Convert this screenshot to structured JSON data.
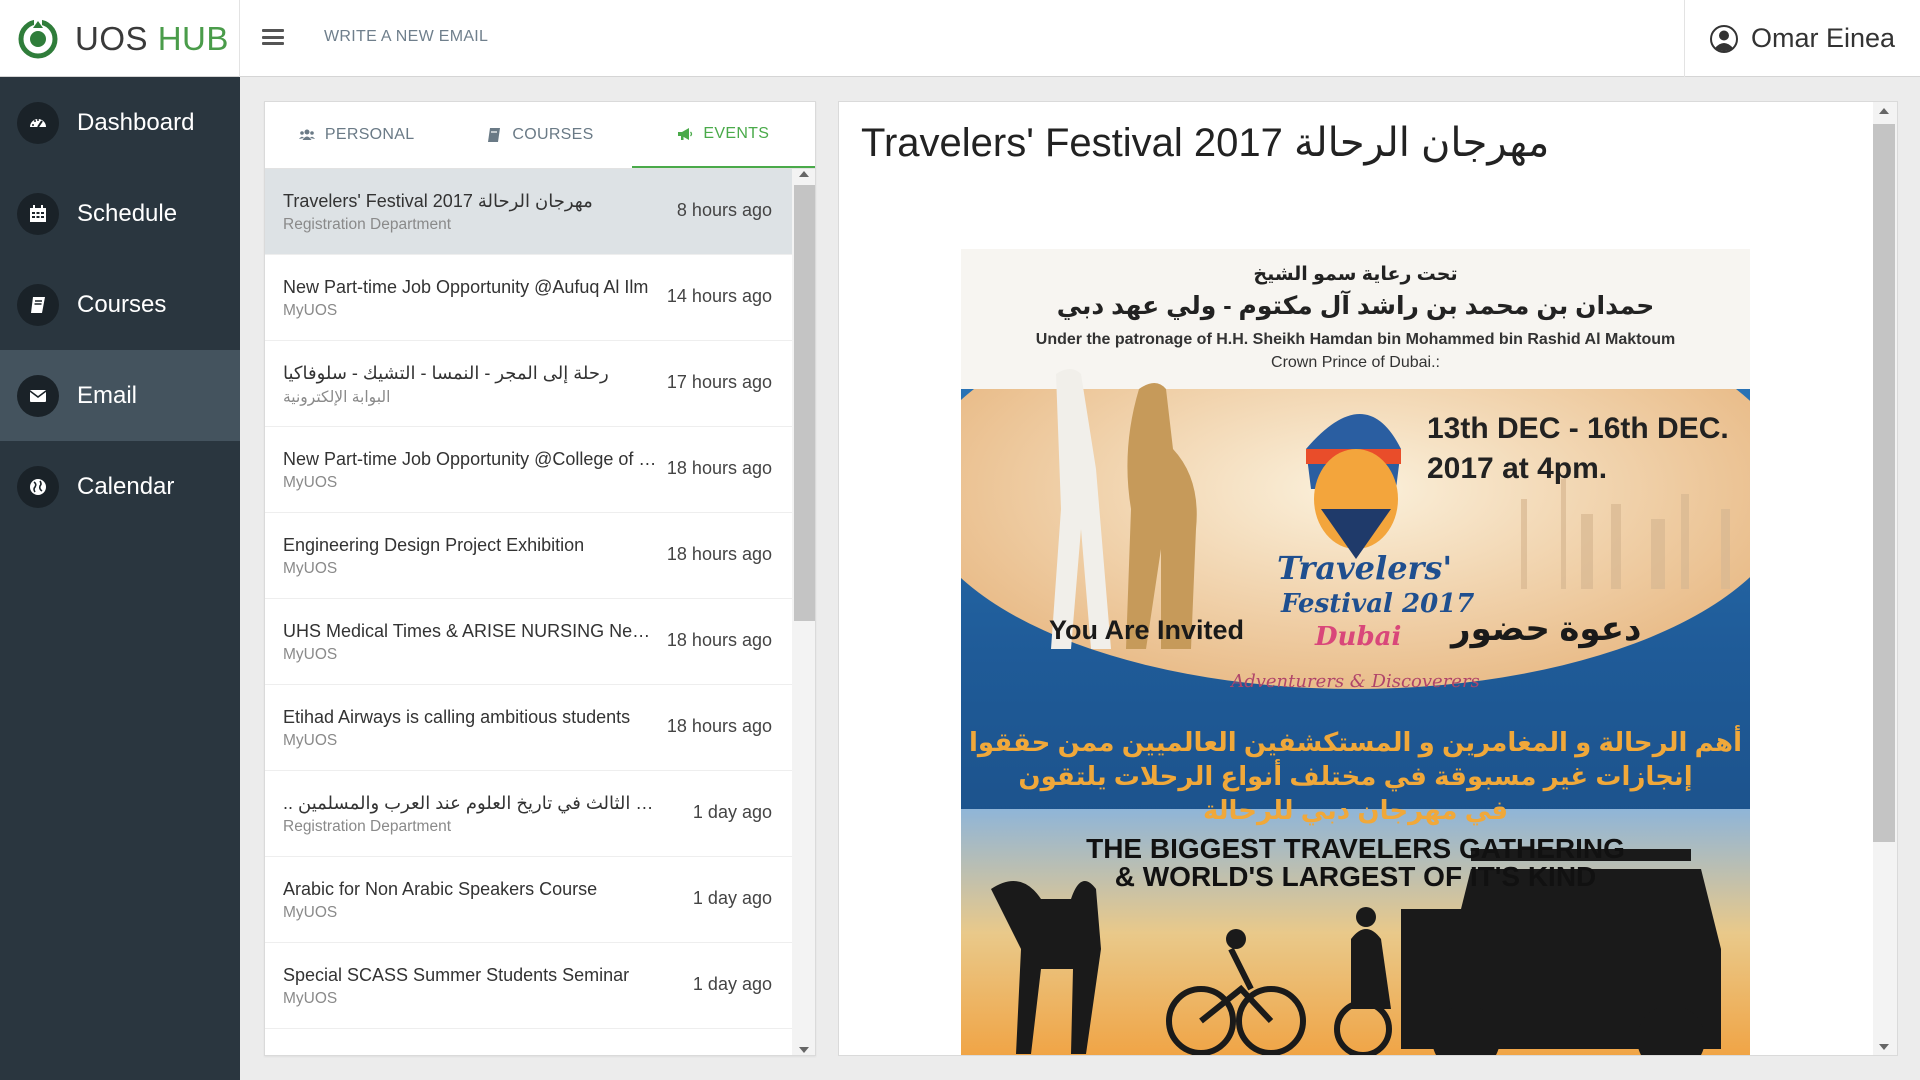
{
  "header": {
    "logo_primary": "UOS",
    "logo_secondary": "HUB",
    "compose_label": "WRITE A NEW EMAIL",
    "user_name": "Omar Einea"
  },
  "sidebar": {
    "items": [
      {
        "label": "Dashboard",
        "icon": "dashboard-icon"
      },
      {
        "label": "Schedule",
        "icon": "calendar-grid-icon"
      },
      {
        "label": "Courses",
        "icon": "book-icon"
      },
      {
        "label": "Email",
        "icon": "envelope-icon",
        "active": true
      },
      {
        "label": "Calendar",
        "icon": "globe-icon"
      }
    ]
  },
  "tabs": [
    {
      "label": "PERSONAL",
      "icon": "users-icon"
    },
    {
      "label": "COURSES",
      "icon": "book-icon"
    },
    {
      "label": "EVENTS",
      "icon": "megaphone-icon",
      "active": true
    }
  ],
  "emails": [
    {
      "subject": "Travelers' Festival 2017 مهرجان الرحالة",
      "sender": "Registration Department",
      "time": "8 hours ago",
      "selected": true
    },
    {
      "subject": "New Part-time Job Opportunity @Aufuq Al Ilm",
      "sender": "MyUOS",
      "time": "14 hours ago"
    },
    {
      "subject": "رحلة إلى المجر - النمسا - التشيك - سلوفاكيا",
      "sender": "البوابة الإلكترونية",
      "time": "17 hours ago"
    },
    {
      "subject": "New Part-time Job Opportunity @College of Business",
      "sender": "MyUOS",
      "time": "18 hours ago"
    },
    {
      "subject": "Engineering Design Project Exhibition",
      "sender": "MyUOS",
      "time": "18 hours ago"
    },
    {
      "subject": "UHS Medical Times & ARISE NURSING Newsletter",
      "sender": "MyUOS",
      "time": "18 hours ago"
    },
    {
      "subject": "Etihad Airways is calling ambitious students",
      "sender": "MyUOS",
      "time": "18 hours ago"
    },
    {
      "subject": ".. لشارقة الدولي الثالث في تاريخ العلوم عند العرب والمسلمين",
      "sender": "Registration Department",
      "time": "1 day ago"
    },
    {
      "subject": "Arabic for Non Arabic Speakers Course",
      "sender": "MyUOS",
      "time": "1 day ago"
    },
    {
      "subject": "Special SCASS Summer Students Seminar",
      "sender": "MyUOS",
      "time": "1 day ago"
    }
  ],
  "reading": {
    "title": "Travelers' Festival 2017 مهرجان الرحالة"
  },
  "poster": {
    "patronage_ar_1": "تحت رعاية سمو الشيخ",
    "patronage_ar_2": "حمدان بن محمد بن راشد آل مكتوم - ولي عهد دبي",
    "patronage_en_1": "Under the patronage of H.H. Sheikh Hamdan bin Mohammed bin Rashid Al Maktoum",
    "patronage_en_2": "Crown Prince of Dubai.:",
    "dates_1": "13th DEC - 16th DEC.",
    "dates_2": "2017 at 4pm.",
    "invited_en": "You Are Invited",
    "invited_ar": "دعوة حضور",
    "logo_line_1": "Travelers'",
    "logo_line_2": "Festival 2017",
    "logo_line_3": "Dubai",
    "tagline": "Adventurers & Discoverers",
    "body_ar_1": "أهم الرحالة و المغامرين و المستكشفين العالميين ممن حققوا",
    "body_ar_2": "إنجازات غير مسبوقة في مختلف أنواع الرحلات يلتقون",
    "body_ar_3": "في مهرجان دبي للرحالة",
    "headline_1": "THE BIGGEST TRAVELERS GATHERING",
    "headline_2": "& WORLD'S LARGEST OF IT'S KIND"
  },
  "colors": {
    "accent_green": "#4aaa4a",
    "sidebar_bg": "#2a363f",
    "sidebar_active": "#44535e",
    "selected_row": "#dde2e5"
  }
}
